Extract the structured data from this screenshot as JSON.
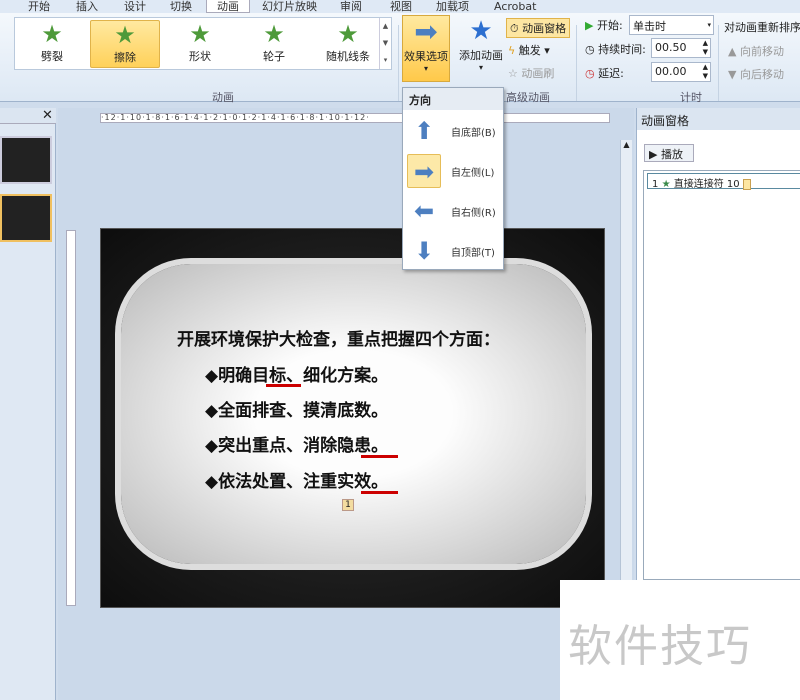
{
  "tabs": [
    "开始",
    "插入",
    "设计",
    "切换",
    "动画",
    "幻灯片放映",
    "审阅",
    "视图",
    "加载项",
    "Acrobat"
  ],
  "gallery": {
    "items": [
      "劈裂",
      "擦除",
      "形状",
      "轮子",
      "随机线条"
    ],
    "selected": "擦除",
    "group_label": "动画"
  },
  "effect_options": {
    "label": "效果选项"
  },
  "advanced": {
    "add_animation": "添加动画",
    "animation_pane": "动画窗格",
    "trigger": "触发",
    "painter": "动画刷",
    "group_label": "高级动画"
  },
  "timing": {
    "start_label": "开始:",
    "start_value": "单击时",
    "duration_label": "持续时间:",
    "duration_value": "00.50",
    "delay_label": "延迟:",
    "delay_value": "00.00",
    "reorder_label": "对动画重新排序",
    "move_earlier": "向前移动",
    "move_later": "向后移动",
    "group_label": "计时"
  },
  "menu": {
    "header": "方向",
    "items": [
      "自底部(B)",
      "自左侧(L)",
      "自右侧(R)",
      "自顶部(T)"
    ],
    "selected": "自左侧(L)"
  },
  "ruler": {
    "h": "·12·1·10·1·8·1·6·1·4·1·2·1·0·1·2·1·4·1·6·1·8·1·10·1·12·"
  },
  "slide": {
    "title": "开展环境保护大检查，重点把握四个方面：",
    "bullets": [
      "◆明确目标、细化方案。",
      "◆全面排查、摸清底数。",
      "◆突出重点、消除隐患。",
      "◆依法处置、注重实效。"
    ],
    "anim_tag": "1"
  },
  "anim_pane": {
    "title": "动画窗格",
    "play": "播放",
    "item_num": "1",
    "item_label": "直接连接符 10"
  },
  "watermark": "软件技巧"
}
